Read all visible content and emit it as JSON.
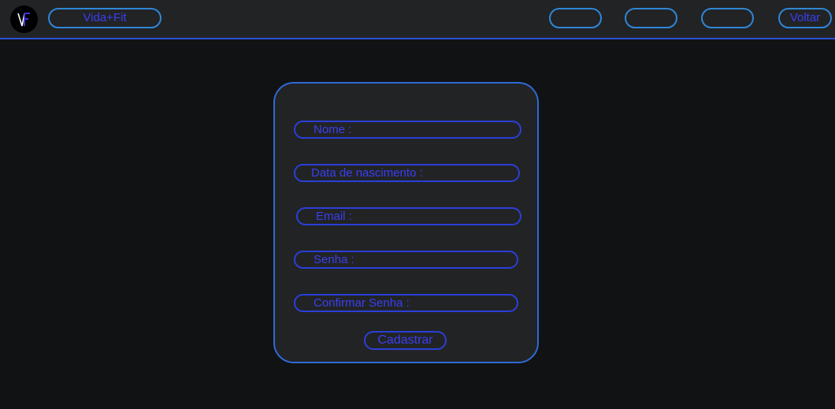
{
  "header": {
    "logo_text": "VF",
    "brand_label": "Vida+Fit",
    "nav_items": [
      "",
      "",
      ""
    ],
    "back_label": "Voltar"
  },
  "form": {
    "fields": [
      {
        "label": "Nome :"
      },
      {
        "label": "Data de nascimento :"
      },
      {
        "label": "Email :"
      },
      {
        "label": "Senha :"
      },
      {
        "label": "Confirmar Senha :"
      }
    ],
    "submit_label": "Cadastrar"
  },
  "colors": {
    "background": "#111213",
    "surface": "#222325",
    "accent_border": "#2e6ad8",
    "field_border": "#2a3fd8",
    "text": "#3a3ff0",
    "logo_v": "#ffffff",
    "logo_f": "#4a3cf0"
  }
}
